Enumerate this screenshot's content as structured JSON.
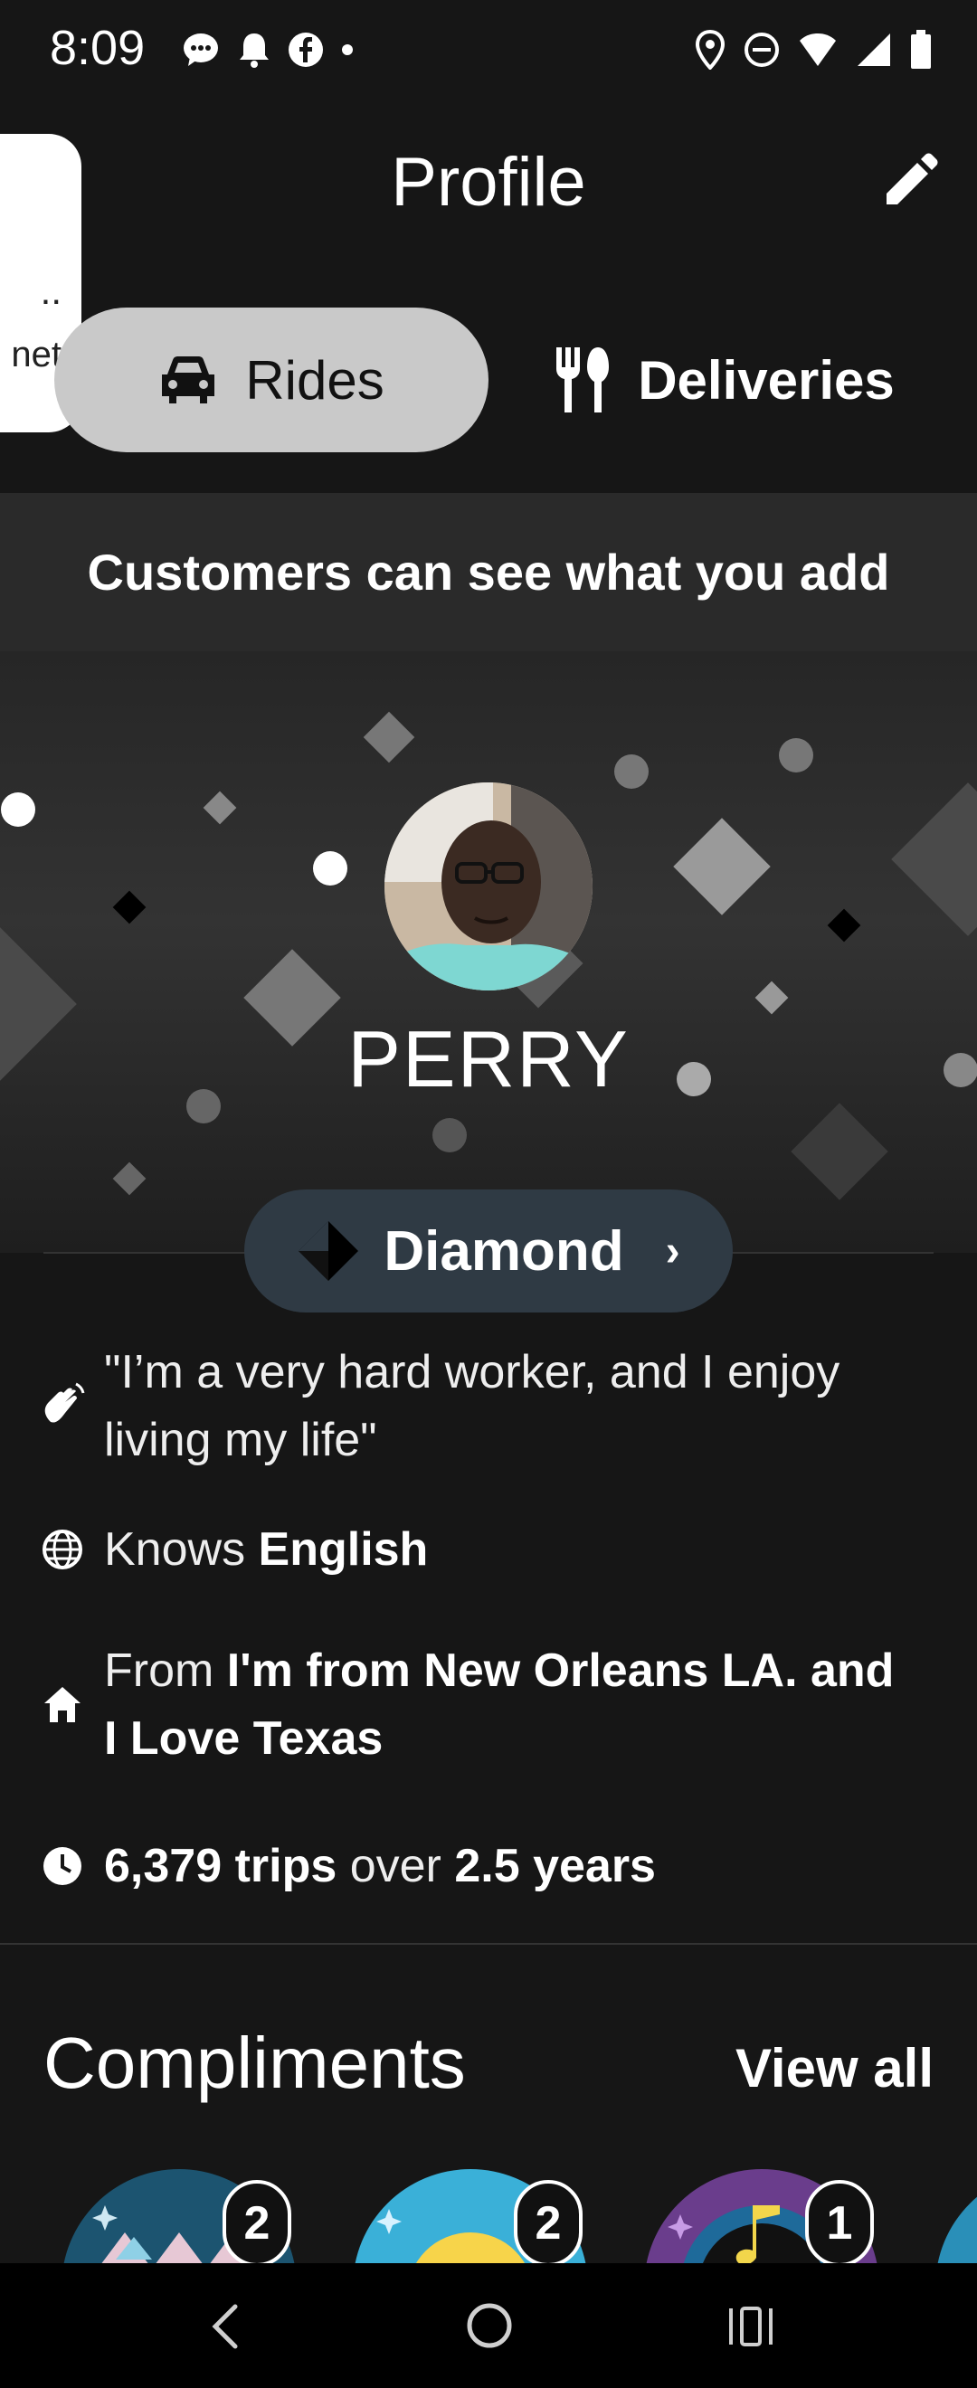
{
  "status_bar": {
    "time": "8:09",
    "left_icons": [
      "messages-icon",
      "bell-icon",
      "facebook-icon",
      "dot-icon"
    ],
    "right_icons": [
      "location-icon",
      "do-not-disturb-icon",
      "wifi-icon",
      "signal-icon",
      "battery-icon"
    ]
  },
  "header": {
    "title": "Profile",
    "edit_icon": "pencil-icon"
  },
  "toast": {
    "text_a": "..",
    "text_b": "net"
  },
  "tabs": {
    "rides_label": "Rides",
    "deliveries_label": "Deliveries",
    "selected": "Rides"
  },
  "banner": {
    "text": "Customers can see what you add"
  },
  "profile": {
    "name": "PERRY",
    "tier": "Diamond"
  },
  "facts": {
    "quote": "\"I’m a very hard worker, and I enjoy living my life\"",
    "knows_prefix": "Knows",
    "knows_value": "English",
    "from_prefix": "From",
    "from_value": "I'm from New Orleans LA. and I Love Texas",
    "trips_value": "6,379 trips",
    "trips_mid": "over",
    "years_value": "2.5 years"
  },
  "compliments": {
    "title": "Compliments",
    "view_all": "View all",
    "badges": [
      {
        "name": "compliment-badge-1",
        "count": "2",
        "color": "#1c5470"
      },
      {
        "name": "compliment-badge-2",
        "count": "2",
        "color": "#3ab0d8"
      },
      {
        "name": "compliment-badge-3",
        "count": "1",
        "color": "#6a3d8c"
      }
    ]
  },
  "colors": {
    "background": "#161616",
    "selected_tab": "#c9c9c9",
    "tier_badge": "#2f3a44",
    "banner": "#2a2a2a"
  }
}
